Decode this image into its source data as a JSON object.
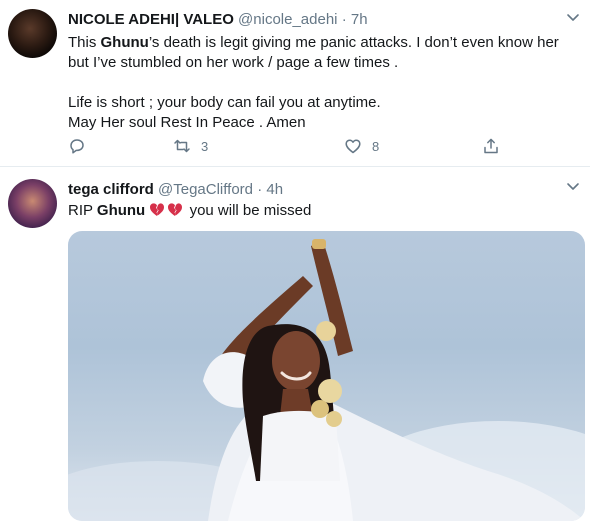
{
  "tweets": [
    {
      "display_name": "NICOLE ADEHI| VALEO",
      "handle": "@nicole_adehi",
      "time": "· 7h",
      "line1_bold": "Ghunu",
      "line1_rest": "’s death is legit giving me panic attacks. I don’t even know her",
      "line1_pre": "This ",
      "line2": "but I’ve stumbled on her work / page a few times .",
      "line3": "Life is short ; your body can fail you at anytime.",
      "line4": "May Her soul Rest In Peace . Amen",
      "retweets": "3",
      "likes": "8"
    },
    {
      "display_name": "tega clifford",
      "handle": "@TegaClifford",
      "time": "· 4h",
      "text_pre": "RIP ",
      "text_bold": "Ghunu",
      "text_post": " you will be missed"
    }
  ],
  "icons": [
    "chevron-down-icon",
    "reply-icon",
    "retweet-icon",
    "like-icon",
    "share-icon",
    "broken-heart-icon"
  ],
  "colors": {
    "muted": "#657786",
    "text": "#14171a",
    "broken_heart": "#d6304a"
  }
}
